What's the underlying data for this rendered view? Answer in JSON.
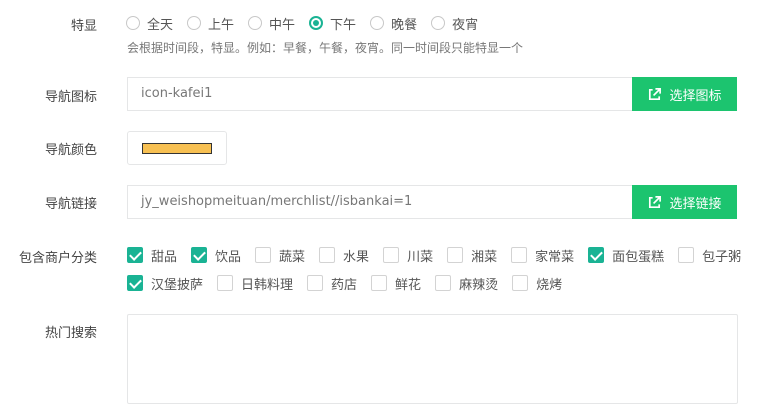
{
  "labels": {
    "featured": "特显",
    "nav_icon": "导航图标",
    "nav_color": "导航颜色",
    "nav_link": "导航链接",
    "merchant_category": "包含商户分类",
    "hot_search": "热门搜索"
  },
  "featured": {
    "options": [
      "全天",
      "上午",
      "中午",
      "下午",
      "晚餐",
      "夜宵"
    ],
    "selected": "下午",
    "help_text": "会根据时间段，特显。例如：早餐，午餐，夜宵。同一时间段只能特显一个"
  },
  "nav_icon": {
    "value": "icon-kafei1",
    "button_label": "选择图标",
    "button_icon": "external-link-icon"
  },
  "nav_color": {
    "value": "#f7c052"
  },
  "nav_link": {
    "value": "jy_weishopmeituan/merchlist//isbankai=1",
    "button_label": "选择链接",
    "button_icon": "external-link-icon"
  },
  "categories": {
    "row1": [
      {
        "label": "甜品",
        "checked": true
      },
      {
        "label": "饮品",
        "checked": true
      },
      {
        "label": "蔬菜",
        "checked": false
      },
      {
        "label": "水果",
        "checked": false
      },
      {
        "label": "川菜",
        "checked": false
      },
      {
        "label": "湘菜",
        "checked": false
      },
      {
        "label": "家常菜",
        "checked": false
      },
      {
        "label": "面包蛋糕",
        "checked": true
      },
      {
        "label": "包子粥",
        "checked": false
      }
    ],
    "row2": [
      {
        "label": "汉堡披萨",
        "checked": true
      },
      {
        "label": "日韩料理",
        "checked": false
      },
      {
        "label": "药店",
        "checked": false
      },
      {
        "label": "鲜花",
        "checked": false
      },
      {
        "label": "麻辣烫",
        "checked": false
      },
      {
        "label": "烧烤",
        "checked": false
      }
    ]
  },
  "hot_search": {
    "value": ""
  },
  "colors": {
    "accent": "#1ab394",
    "button": "#1cc46f"
  }
}
